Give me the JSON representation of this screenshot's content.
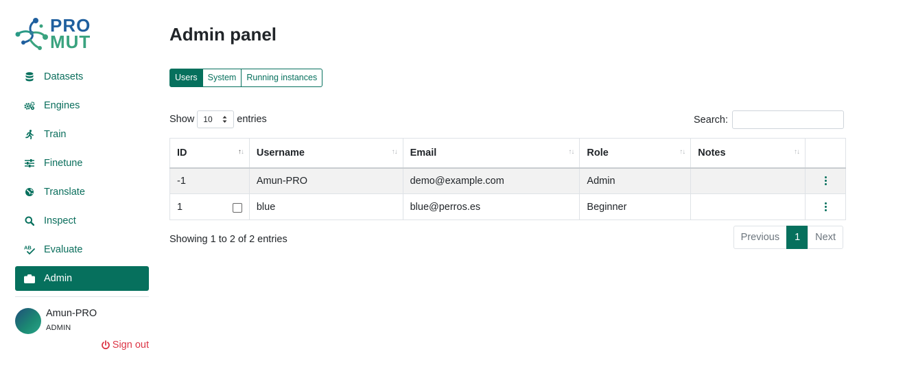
{
  "app": {
    "logo_line1": "PRO",
    "logo_line2": "MUT"
  },
  "colors": {
    "primary": "#06705d",
    "danger": "#dc3545",
    "logo_blue": "#1f5f9e",
    "logo_green": "#3aa37f"
  },
  "sidebar": {
    "items": [
      {
        "label": "Datasets",
        "icon": "database-icon"
      },
      {
        "label": "Engines",
        "icon": "gears-icon"
      },
      {
        "label": "Train",
        "icon": "running-icon"
      },
      {
        "label": "Finetune",
        "icon": "sliders-icon"
      },
      {
        "label": "Translate",
        "icon": "globe-icon"
      },
      {
        "label": "Inspect",
        "icon": "search-icon"
      },
      {
        "label": "Evaluate",
        "icon": "spellcheck-icon"
      },
      {
        "label": "Admin",
        "icon": "toolbox-icon",
        "active": true
      }
    ],
    "user": {
      "name": "Amun-PRO",
      "role": "ADMIN"
    },
    "signout": "Sign out"
  },
  "main": {
    "title": "Admin panel",
    "tabs": [
      {
        "label": "Users",
        "active": true
      },
      {
        "label": "System"
      },
      {
        "label": "Running instances"
      }
    ],
    "length": {
      "show": "Show",
      "value": "10",
      "entries": "entries"
    },
    "search": {
      "label": "Search:",
      "value": ""
    },
    "table": {
      "columns": [
        "ID",
        "Username",
        "Email",
        "Role",
        "Notes",
        ""
      ],
      "rows": [
        {
          "id": "-1",
          "username": "Amun-PRO",
          "email": "demo@example.com",
          "role": "Admin",
          "notes": "",
          "checkbox": false
        },
        {
          "id": "1",
          "username": "blue",
          "email": "blue@perros.es",
          "role": "Beginner",
          "notes": "",
          "checkbox": true
        }
      ]
    },
    "info": "Showing 1 to 2 of 2 entries",
    "pager": {
      "previous": "Previous",
      "current": "1",
      "next": "Next"
    }
  }
}
